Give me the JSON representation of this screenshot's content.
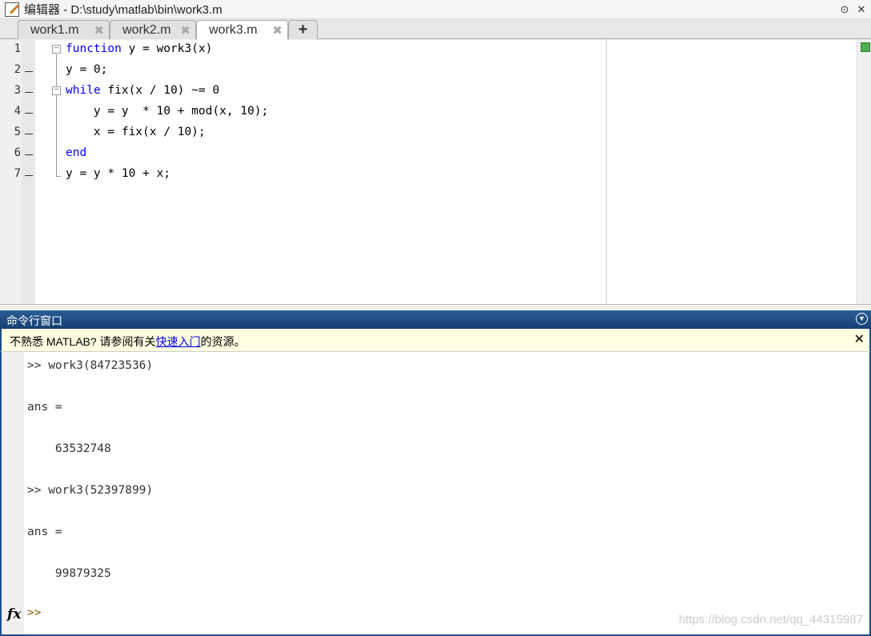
{
  "window": {
    "title": "编辑器 - D:\\study\\matlab\\bin\\work3.m"
  },
  "tabs": [
    {
      "label": "work1.m"
    },
    {
      "label": "work2.m"
    },
    {
      "label": "work3.m",
      "active": true
    }
  ],
  "add_tab_label": "+",
  "editor": {
    "lines": [
      {
        "num": "1",
        "kw": "function",
        "rest": " y = work3(x)"
      },
      {
        "num": "2",
        "kw": "",
        "rest": "y = 0;"
      },
      {
        "num": "3",
        "kw": "while",
        "rest": " fix(x / 10) ~= 0"
      },
      {
        "num": "4",
        "kw": "",
        "rest": "    y = y  * 10 + mod(x, 10);"
      },
      {
        "num": "5",
        "kw": "",
        "rest": "    x = fix(x / 10);"
      },
      {
        "num": "6",
        "kw": "end",
        "rest": ""
      },
      {
        "num": "7",
        "kw": "",
        "rest": "y = y * 10 + x;"
      }
    ],
    "keyword_color": "#0000ff",
    "status_color": "#4caf50"
  },
  "command_window": {
    "title": "命令行窗口",
    "notice": {
      "before": "不熟悉 MATLAB? 请参阅有关",
      "link": "快速入门",
      "after": "的资源。"
    },
    "lines": [
      ">> work3(84723536)",
      "ans =",
      "    63532748",
      ">> work3(52397899)",
      "ans =",
      "    99879325"
    ],
    "prompt": ">>",
    "fx": "fx",
    "watermark": "https://blog.csdn.net/qq_44315987"
  }
}
